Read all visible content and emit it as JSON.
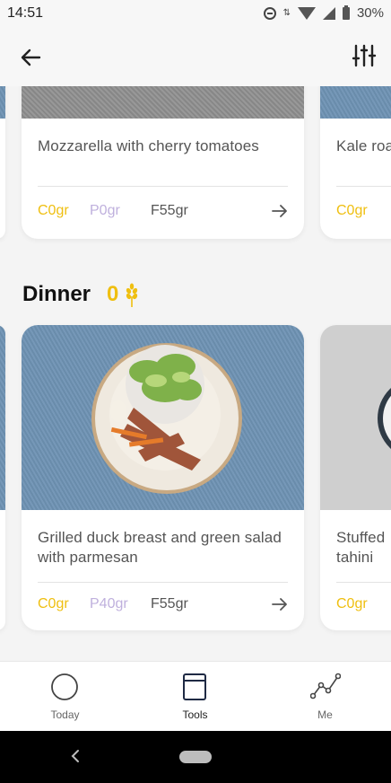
{
  "status_bar": {
    "time": "14:51",
    "battery": "30%"
  },
  "header": {
    "back_icon": "arrow-left-icon",
    "filter_icon": "sliders-icon"
  },
  "lunch_cards": [
    {
      "title": "Mozzarella with cherry tomatoes",
      "carbs": "C0gr",
      "protein": "P0gr",
      "fat": "F55gr"
    },
    {
      "title": "Kale roa",
      "carbs": "C0gr"
    }
  ],
  "dinner": {
    "title": "Dinner",
    "count": "0",
    "count_icon": "wheat-icon",
    "cards": [
      {
        "title": "Grilled duck breast and green salad with parmesan",
        "carbs": "C0gr",
        "protein": "P40gr",
        "fat": "F55gr"
      },
      {
        "title": "Stuffed\ntahini",
        "carbs": "C0gr"
      }
    ]
  },
  "bottom_nav": [
    {
      "label": "Today",
      "icon": "circle-icon",
      "active": false
    },
    {
      "label": "Tools",
      "icon": "notebook-icon",
      "active": true
    },
    {
      "label": "Me",
      "icon": "graph-line-icon",
      "active": false
    }
  ],
  "colors": {
    "carbs": "#efbf10",
    "protein": "#bfb0dd",
    "fat": "#555555",
    "accent": "#efbf10",
    "nav_active": "#1f2a44"
  }
}
